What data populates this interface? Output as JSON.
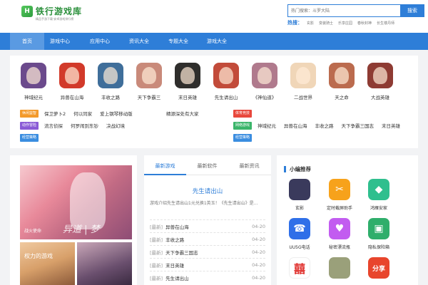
{
  "header": {
    "logo_text": "铁行游戏库",
    "logo_sub": "精品手游下载·安卓游戏排行榜",
    "search_placeholder": "热门搜索：斗罗大陆",
    "search_button": "搜索",
    "hot_label": "热搜：",
    "hot_links": [
      "玄影",
      "变装骑士",
      "乐享庄园",
      "春秋封神",
      "长生楼丹师"
    ]
  },
  "nav": {
    "items": [
      "首页",
      "游戏中心",
      "应用中心",
      "资讯大全",
      "专题大全",
      "游戏大全"
    ],
    "active_index": 0
  },
  "top_apps": [
    {
      "name": "神域纪元",
      "color": "#6b4a8c"
    },
    {
      "name": "异兽在山海",
      "color": "#d23a2a"
    },
    {
      "name": "丰收之路",
      "color": "#3f6e9a"
    },
    {
      "name": "天下争霸三",
      "color": "#c98a7a"
    },
    {
      "name": "末日英雄",
      "color": "#2f2e2c"
    },
    {
      "name": "先生请出山",
      "color": "#c24b3a"
    },
    {
      "name": "《神仙道》",
      "color": "#b07a8d"
    },
    {
      "name": "二战世界",
      "color": "#f0d6b8"
    },
    {
      "name": "天之命",
      "color": "#bb6b4e"
    },
    {
      "name": "大战英雄",
      "color": "#8e3b33"
    }
  ],
  "tag_rows": [
    {
      "tag": "休闲益智",
      "tag_color": "#f39a2b",
      "links": [
        "保卫萝卜2",
        "何以同家",
        "爱上钢琴移动版"
      ]
    },
    {
      "tag": "体育竞技",
      "tag_color": "#e8473c",
      "links": [
        "精源深处有大家"
      ]
    },
    {
      "tag": "动作冒险",
      "tag_color": "#8a5bd6",
      "links": [
        "流言侦探",
        "何罗闹到东钞",
        "决战幻境"
      ]
    },
    {
      "tag": "网络游戏",
      "tag_color": "#3bb56a",
      "links": [
        "神域纪元",
        "异兽在山海",
        "丰收之路",
        "天下争霸三国志",
        "末日英雄"
      ]
    },
    {
      "tag": "经营策略",
      "tag_color": "#3a8de0",
      "links": []
    }
  ],
  "banner": {
    "caption": "战火使命",
    "title": "异道 | 梦"
  },
  "thumbs": [
    {
      "label": "权力的游戏",
      "color": "#d8a06a"
    },
    {
      "label": "",
      "color": "#6a4f6e"
    }
  ],
  "tabs": {
    "items": [
      "最新游戏",
      "最新软件",
      "最新资讯"
    ],
    "active_index": 0
  },
  "feature": {
    "title": "先生请出山",
    "desc": "游戏介绍先生请出山1元兑换1英玉！《先生请出山》是..."
  },
  "news": [
    {
      "cat": "[最新]",
      "title": "异兽在山海",
      "date": "04-20"
    },
    {
      "cat": "[最新]",
      "title": "丰收之路",
      "date": "04-20"
    },
    {
      "cat": "[最新]",
      "title": "天下争霸三国志",
      "date": "04-20"
    },
    {
      "cat": "[最新]",
      "title": "末日英雄",
      "date": "04-20"
    },
    {
      "cat": "[最新]",
      "title": "先生请出山",
      "date": "04-20"
    }
  ],
  "recommend": {
    "title": "小编推荐",
    "items": [
      {
        "name": "玄影",
        "color": "#3a3a5c",
        "glyph": ""
      },
      {
        "name": "定时截屏助手",
        "color": "#f7a21b",
        "glyph": "✂"
      },
      {
        "name": "鸿雁安家",
        "color": "#2fbf8e",
        "glyph": "◆"
      },
      {
        "name": "UU5G电话",
        "color": "#2f6fe8",
        "glyph": "☎"
      },
      {
        "name": "秘密漂流瓶",
        "color": "#c25cf0",
        "glyph": "♥"
      },
      {
        "name": "隐私保险箱",
        "color": "#2fae6b",
        "glyph": "▣"
      },
      {
        "name": "",
        "color": "#e0332f",
        "glyph": "囍"
      },
      {
        "name": "",
        "color": "#9aa07a",
        "glyph": ""
      },
      {
        "name": "",
        "color": "#e8452c",
        "glyph": "分享"
      }
    ]
  }
}
